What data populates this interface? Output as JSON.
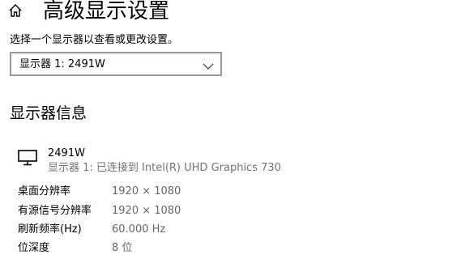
{
  "header": {
    "icon": "home-icon",
    "title": "高级显示设置"
  },
  "subtitle": "选择一个显示器以查看或更改设置。",
  "display_select": {
    "selected": "显示器 1: 2491W",
    "icon": "chevron-down-icon"
  },
  "section": {
    "title": "显示器信息"
  },
  "monitor": {
    "icon": "monitor-icon",
    "name": "2491W",
    "description": "显示器 1: 已连接到 Intel(R) UHD Graphics 730"
  },
  "info_rows": [
    {
      "label": "桌面分辨率",
      "value": "1920 × 1080"
    },
    {
      "label": "有源信号分辨率",
      "value": "1920 × 1080"
    },
    {
      "label": "刷新频率(Hz)",
      "value": "60.000 Hz"
    },
    {
      "label": "位深度",
      "value": "8 位"
    }
  ]
}
